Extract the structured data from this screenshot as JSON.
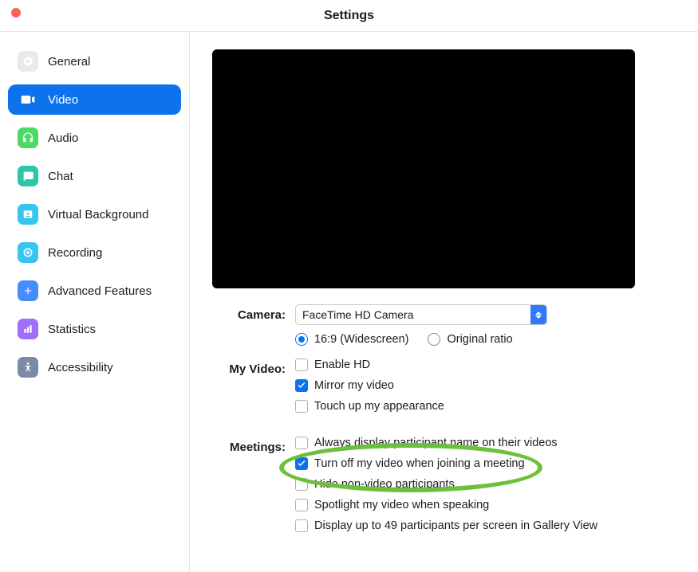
{
  "window": {
    "title": "Settings"
  },
  "sidebar": {
    "items": [
      {
        "key": "general",
        "label": "General"
      },
      {
        "key": "video",
        "label": "Video"
      },
      {
        "key": "audio",
        "label": "Audio"
      },
      {
        "key": "chat",
        "label": "Chat"
      },
      {
        "key": "virtual-background",
        "label": "Virtual Background"
      },
      {
        "key": "recording",
        "label": "Recording"
      },
      {
        "key": "advanced-features",
        "label": "Advanced Features"
      },
      {
        "key": "statistics",
        "label": "Statistics"
      },
      {
        "key": "accessibility",
        "label": "Accessibility"
      }
    ],
    "active_index": 1
  },
  "video": {
    "camera_label": "Camera:",
    "camera_value": "FaceTime HD Camera",
    "ratio_16_9": "16:9 (Widescreen)",
    "ratio_original": "Original ratio",
    "ratio_selected": "16:9",
    "myvideo_label": "My Video:",
    "enable_hd": "Enable HD",
    "enable_hd_checked": false,
    "mirror": "Mirror my video",
    "mirror_checked": true,
    "touch_up": "Touch up my appearance",
    "touch_up_checked": false,
    "meetings_label": "Meetings:",
    "always_display": "Always display participant name on their videos",
    "always_display_checked": false,
    "turn_off_join": "Turn off my video when joining a meeting",
    "turn_off_join_checked": true,
    "hide_nonvideo": "Hide non-video participants",
    "hide_nonvideo_checked": false,
    "spotlight": "Spotlight my video when speaking",
    "spotlight_checked": false,
    "display49": "Display up to 49 participants per screen in Gallery View",
    "display49_checked": false
  },
  "highlight": {
    "target": "turn_off_join"
  },
  "colors": {
    "accent": "#0e72ed",
    "highlight": "#6dbf3e"
  }
}
